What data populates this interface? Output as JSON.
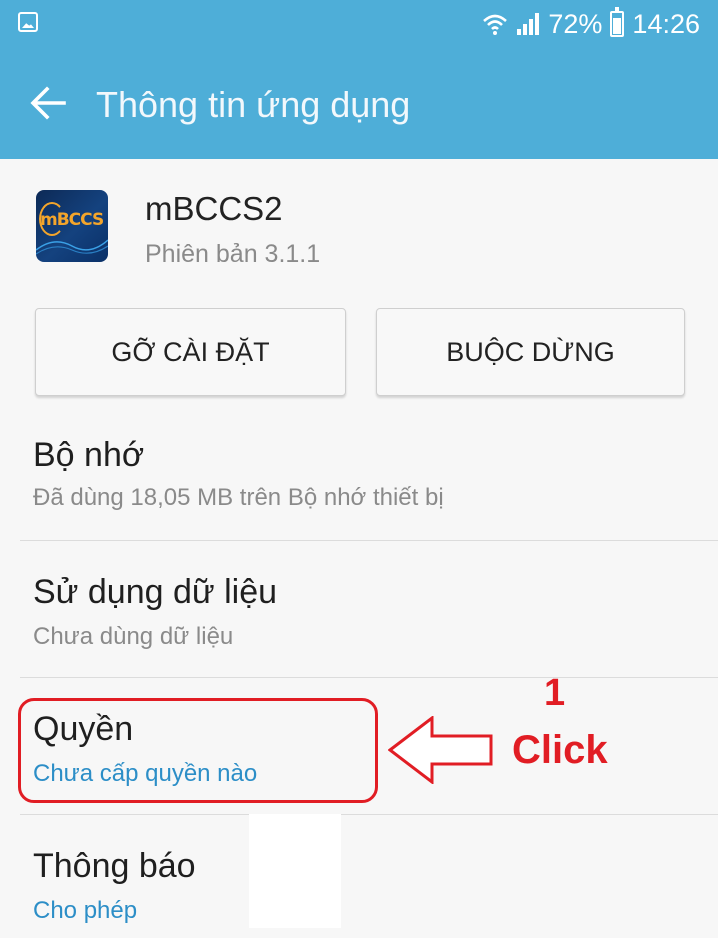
{
  "status_bar": {
    "battery": "72%",
    "time": "14:26",
    "icons": [
      "gallery-icon",
      "wifi-icon",
      "signal-icon",
      "battery-icon"
    ]
  },
  "app_bar": {
    "title": "Thông tin ứng dụng",
    "back_icon": "back-arrow-icon"
  },
  "app": {
    "name": "mBCCS2",
    "version": "Phiên bản 3.1.1",
    "icon_text": "mBCCS"
  },
  "buttons": {
    "uninstall": "GỠ CÀI ĐẶT",
    "force_stop": "BUỘC DỪNG"
  },
  "sections": {
    "storage": {
      "title": "Bộ nhớ",
      "subtitle": "Đã dùng 18,05 MB trên Bộ nhớ thiết bị"
    },
    "data_usage": {
      "title": "Sử dụng dữ liệu",
      "subtitle": "Chưa dùng dữ liệu"
    },
    "permissions": {
      "title": "Quyền",
      "subtitle": "Chưa cấp quyền nào"
    },
    "notifications": {
      "title": "Thông báo",
      "subtitle": "Cho phép"
    }
  },
  "annotation": {
    "number": "1",
    "label": "Click"
  },
  "colors": {
    "app_bar": "#4eaed8",
    "link": "#2c8ec7",
    "annotation": "#e11d24",
    "background": "#f7f7f7"
  }
}
